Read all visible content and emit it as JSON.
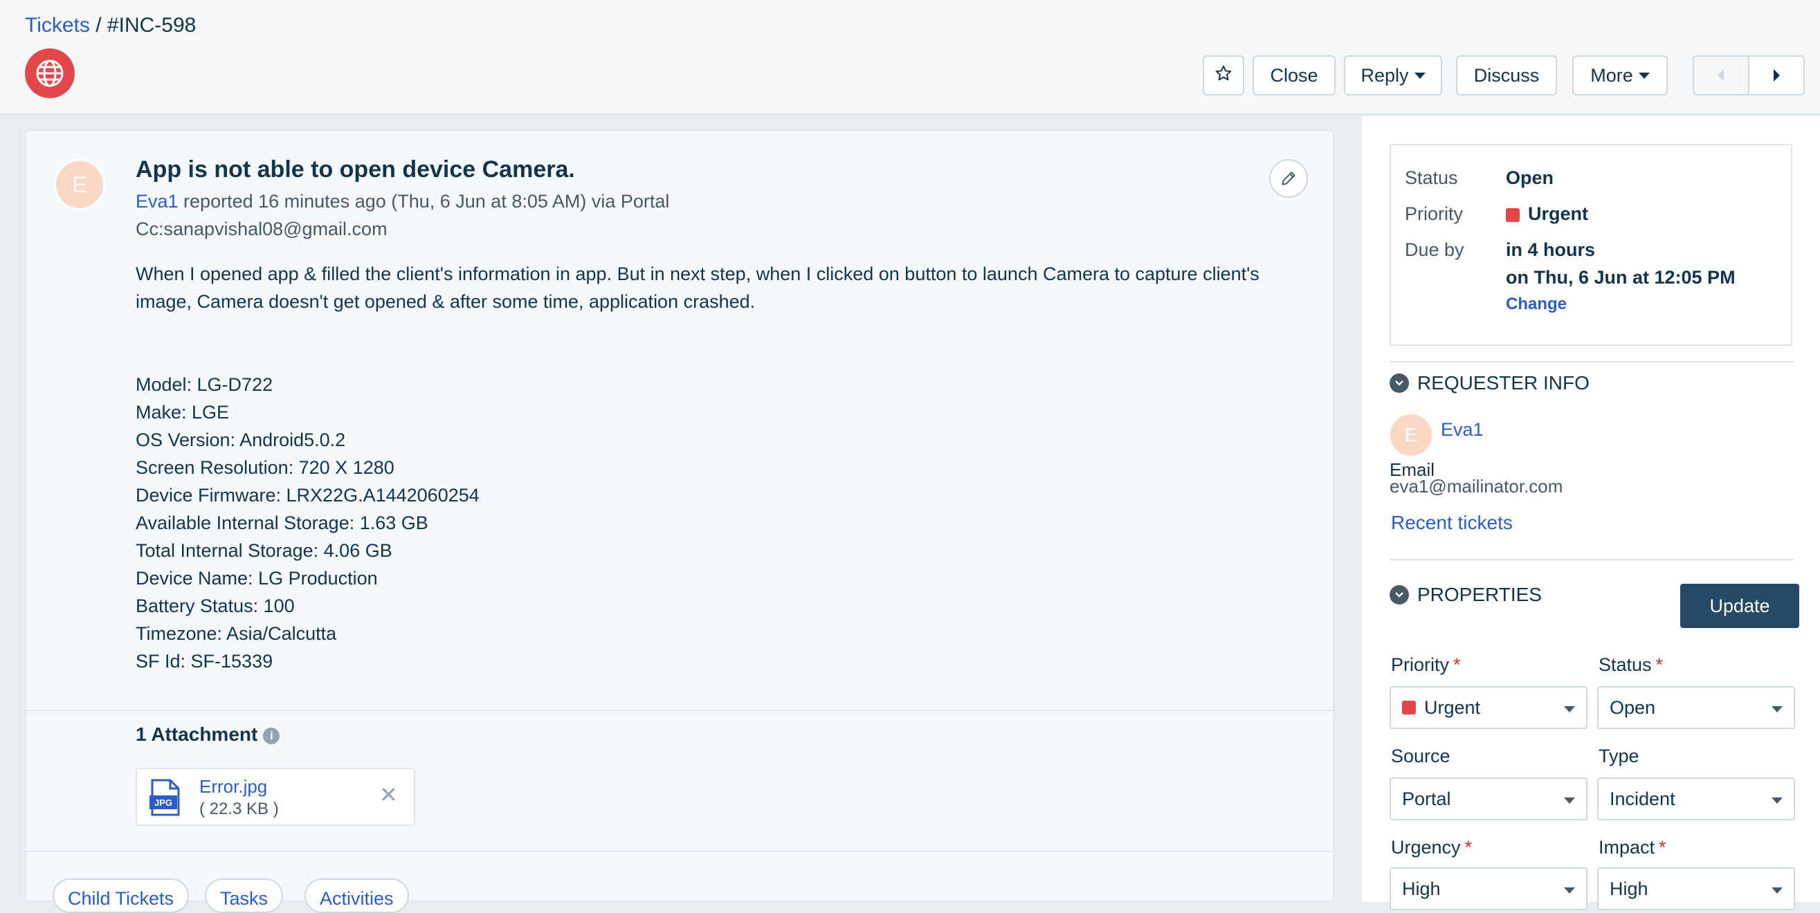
{
  "breadcrumb": {
    "root": "Tickets",
    "separator": " / ",
    "current": "#INC-598"
  },
  "toolbar": {
    "star_icon": "star-icon",
    "close_label": "Close",
    "reply_label": "Reply",
    "discuss_label": "Discuss",
    "more_label": "More"
  },
  "ticket": {
    "avatar_letter": "E",
    "subject": "App is not able to open device Camera.",
    "requester": "Eva1",
    "meta_text": " reported 16 minutes ago (Thu, 6 Jun at 8:05 AM) via Portal",
    "cc": "Cc:sanapvishal08@gmail.com",
    "description": "When I opened app & filled the client's information in app. But in next step, when I clicked on button to launch Camera to capture client's image, Camera doesn't get opened & after some time, application crashed.",
    "details": [
      "Model: LG-D722",
      "Make: LGE",
      "OS Version: Android5.0.2",
      "Screen Resolution: 720 X 1280",
      "Device Firmware: LRX22G.A1442060254",
      "Available Internal Storage: 1.63 GB",
      "Total Internal Storage: 4.06 GB",
      "Device Name: LG Production",
      "Battery Status: 100",
      "Timezone: Asia/Calcutta",
      "SF Id: SF-15339"
    ],
    "attachments_title": "1 Attachment",
    "attachment": {
      "name": "Error.jpg",
      "size": "( 22.3 KB )",
      "badge": "JPG"
    }
  },
  "tabs": [
    "Child Tickets",
    "Tasks",
    "Activities"
  ],
  "status_card": {
    "status_label": "Status",
    "status_value": "Open",
    "priority_label": "Priority",
    "priority_value": "Urgent",
    "due_label": "Due by",
    "due_line1": "in 4 hours",
    "due_line2": "on Thu, 6 Jun at 12:05 PM",
    "change_label": "Change"
  },
  "requester_info": {
    "heading": "REQUESTER INFO",
    "avatar_letter": "E",
    "name": "Eva1",
    "email_label": "Email",
    "email": "eva1@mailinator.com",
    "recent_tickets": "Recent tickets"
  },
  "properties": {
    "heading": "PROPERTIES",
    "update_label": "Update",
    "fields": {
      "priority": {
        "label": "Priority",
        "value": "Urgent"
      },
      "status": {
        "label": "Status",
        "value": "Open"
      },
      "source": {
        "label": "Source",
        "value": "Portal"
      },
      "type": {
        "label": "Type",
        "value": "Incident"
      },
      "urgency": {
        "label": "Urgency",
        "value": "High"
      },
      "impact": {
        "label": "Impact",
        "value": "High"
      }
    }
  },
  "colors": {
    "accent": "#2c5cc5",
    "urgent": "#e2474b",
    "primary_button": "#264966"
  }
}
